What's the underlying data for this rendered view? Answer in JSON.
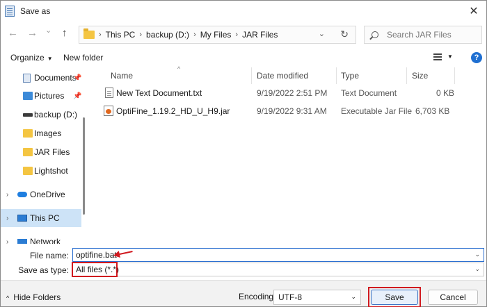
{
  "window": {
    "title": "Save as",
    "close_glyph": "✕"
  },
  "nav": {
    "back_glyph": "←",
    "forward_glyph": "→",
    "recent_glyph": "⌄",
    "up_glyph": "↑",
    "breadcrumbs": [
      "This PC",
      "backup (D:)",
      "My Files",
      "JAR Files"
    ],
    "separator": "›",
    "dropdown_glyph": "⌄",
    "refresh_glyph": "↻",
    "search_placeholder": "Search JAR Files"
  },
  "commands": {
    "organize": "Organize",
    "organize_caret": "▼",
    "new_folder": "New folder",
    "view_caret": "▼",
    "help_glyph": "?"
  },
  "sidebar": {
    "items": [
      {
        "label": "Documents",
        "icon": "documents-icon",
        "pinned": true
      },
      {
        "label": "Pictures",
        "icon": "pictures-icon",
        "pinned": true
      },
      {
        "label": "backup (D:)",
        "icon": "drive-icon",
        "pinned": false
      },
      {
        "label": "Images",
        "icon": "folder-icon",
        "pinned": false
      },
      {
        "label": "JAR Files",
        "icon": "folder-icon",
        "pinned": false
      },
      {
        "label": "Lightshot",
        "icon": "folder-icon",
        "pinned": false
      },
      {
        "label": "OneDrive",
        "icon": "onedrive-icon",
        "expandable": true
      },
      {
        "label": "This PC",
        "icon": "this-pc-icon",
        "expandable": true,
        "selected": true
      },
      {
        "label": "Network",
        "icon": "network-icon",
        "expandable": true
      }
    ],
    "pin_glyph": "📌",
    "expander_glyph": "›"
  },
  "filelist": {
    "sort_glyph": "^",
    "columns": {
      "name": "Name",
      "date": "Date modified",
      "type": "Type",
      "size": "Size"
    },
    "rows": [
      {
        "name": "New Text Document.txt",
        "date": "9/19/2022 2:51 PM",
        "type": "Text Document",
        "size": "0 KB",
        "icon": "text-file-icon"
      },
      {
        "name": "OptiFine_1.19.2_HD_U_H9.jar",
        "date": "9/19/2022 9:31 AM",
        "type": "Executable Jar File",
        "size": "6,703 KB",
        "icon": "jar-file-icon"
      }
    ]
  },
  "fields": {
    "file_name_label": "File name:",
    "file_name_value": "optifine.bat",
    "save_type_label": "Save as type:",
    "save_type_value": "All files  (*.*)",
    "dropdown_glyph": "⌄"
  },
  "footer": {
    "hide_folders": "Hide Folders",
    "hide_caret": "^",
    "encoding_label": "Encoding:",
    "encoding_value": "UTF-8",
    "encoding_caret": "⌄",
    "save": "Save",
    "cancel": "Cancel"
  },
  "colors": {
    "accent": "#2b6fd0",
    "highlight_annotation": "#d0191f",
    "selection": "#cde3f7"
  }
}
